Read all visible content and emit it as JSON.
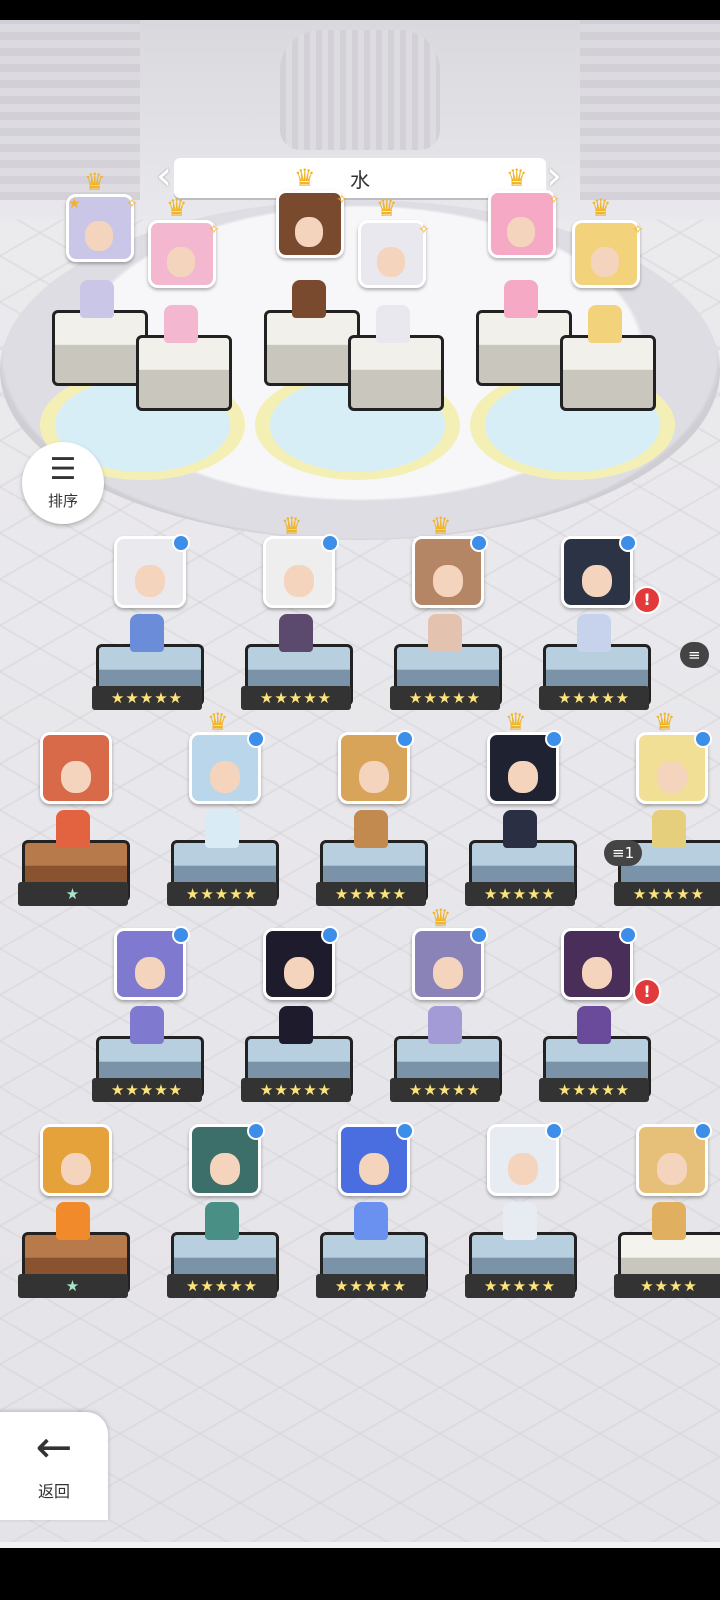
{
  "element_banner": {
    "title": "水"
  },
  "sort_button": {
    "label": "排序",
    "icon": "sort-icon"
  },
  "back_button": {
    "label": "返回",
    "icon": "arrow-left-icon"
  },
  "team": [
    {
      "crown": true,
      "leader_star": true,
      "hair": "#c9c6e8",
      "sprite": "#c9c6e8"
    },
    {
      "crown": true,
      "leader_star": false,
      "hair": "#f3b8cf",
      "sprite": "#f3b8cf"
    },
    {
      "crown": true,
      "leader_star": false,
      "hair": "#7a4a2f",
      "sprite": "#7a4a2f"
    },
    {
      "crown": true,
      "leader_star": false,
      "hair": "#e8e8ee",
      "sprite": "#e8e8ee"
    },
    {
      "crown": true,
      "leader_star": false,
      "hair": "#f5a9c4",
      "sprite": "#f5a9c4"
    },
    {
      "crown": true,
      "leader_star": false,
      "hair": "#f2d27a",
      "sprite": "#f2d27a"
    }
  ],
  "roster_rows": [
    [
      {
        "crown": false,
        "element": true,
        "alert": false,
        "hair": "#e9e9ee",
        "sprite": "#6b8cd8",
        "stars": "★★★★★",
        "ped": "blue"
      },
      {
        "crown": true,
        "element": true,
        "alert": false,
        "hair": "#eeeeee",
        "sprite": "#5b4a6e",
        "stars": "★★★★★",
        "ped": "blue"
      },
      {
        "crown": true,
        "element": true,
        "alert": false,
        "hair": "#b48666",
        "sprite": "#e3c3b0",
        "stars": "★★★★★",
        "ped": "blue"
      },
      {
        "crown": false,
        "element": true,
        "alert": true,
        "hair": "#2c3344",
        "sprite": "#c7d3ec",
        "stars": "★★★★★",
        "ped": "blue"
      }
    ],
    [
      {
        "crown": false,
        "element": false,
        "alert": false,
        "hair": "#d86a4a",
        "sprite": "#e3623f",
        "stars": "★",
        "ped": "brown"
      },
      {
        "crown": true,
        "element": true,
        "alert": false,
        "hair": "#b9d6ea",
        "sprite": "#d9ebf5",
        "stars": "★★★★★",
        "ped": "blue"
      },
      {
        "crown": false,
        "element": true,
        "alert": false,
        "hair": "#d8a45a",
        "sprite": "#c38a50",
        "stars": "★★★★★",
        "ped": "blue"
      },
      {
        "crown": true,
        "element": true,
        "alert": false,
        "hair": "#1f2230",
        "sprite": "#2b2f44",
        "stars": "★★★★★",
        "ped": "blue"
      },
      {
        "crown": true,
        "element": true,
        "alert": false,
        "hair": "#f2df96",
        "sprite": "#e6cf7c",
        "stars": "★★★★★",
        "ped": "blue"
      }
    ],
    [
      {
        "crown": false,
        "element": true,
        "alert": false,
        "hair": "#7f7ad0",
        "sprite": "#7f7ad0",
        "stars": "★★★★★",
        "ped": "blue"
      },
      {
        "crown": false,
        "element": true,
        "alert": false,
        "hair": "#1e1c2c",
        "sprite": "#1e1c2c",
        "stars": "★★★★★",
        "ped": "blue"
      },
      {
        "crown": true,
        "element": true,
        "alert": false,
        "hair": "#8a83b8",
        "sprite": "#a39bd6",
        "stars": "★★★★★",
        "ped": "blue"
      },
      {
        "crown": false,
        "element": true,
        "alert": true,
        "hair": "#4a2e5a",
        "sprite": "#6a4a9a",
        "stars": "★★★★★",
        "ped": "blue"
      }
    ],
    [
      {
        "crown": false,
        "element": false,
        "alert": false,
        "hair": "#e5a23a",
        "sprite": "#f08a2a",
        "stars": "★",
        "ped": "brown"
      },
      {
        "crown": false,
        "element": true,
        "alert": false,
        "hair": "#3c6e6a",
        "sprite": "#4a8f86",
        "stars": "★★★★★",
        "ped": "blue"
      },
      {
        "crown": false,
        "element": true,
        "alert": false,
        "hair": "#4a6ee0",
        "sprite": "#6a90f0",
        "stars": "★★★★★",
        "ped": "blue"
      },
      {
        "crown": false,
        "element": true,
        "alert": false,
        "hair": "#e6ecf2",
        "sprite": "#e6ecf2",
        "stars": "★★★★★",
        "ped": "blue"
      },
      {
        "crown": false,
        "element": true,
        "alert": false,
        "hair": "#e6c078",
        "sprite": "#e0b060",
        "stars": "★★★★",
        "ped": "white"
      }
    ]
  ],
  "pill_badges": [
    "≡1"
  ]
}
